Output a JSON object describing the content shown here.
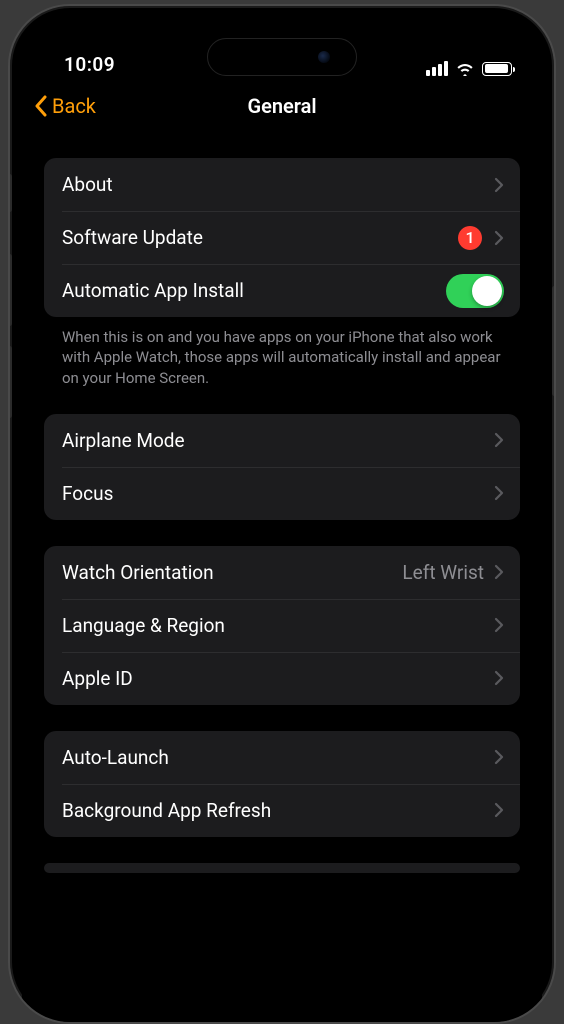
{
  "status": {
    "time": "10:09"
  },
  "nav": {
    "back_label": "Back",
    "title": "General"
  },
  "group1": {
    "about": "About",
    "software_update": "Software Update",
    "software_update_badge": "1",
    "auto_install": "Automatic App Install",
    "footer": "When this is on and you have apps on your iPhone that also work with Apple Watch, those apps will automatically install and appear on your Home Screen."
  },
  "group2": {
    "airplane": "Airplane Mode",
    "focus": "Focus"
  },
  "group3": {
    "orientation": "Watch Orientation",
    "orientation_value": "Left Wrist",
    "language": "Language & Region",
    "apple_id": "Apple ID"
  },
  "group4": {
    "auto_launch": "Auto-Launch",
    "bg_refresh": "Background App Refresh"
  }
}
